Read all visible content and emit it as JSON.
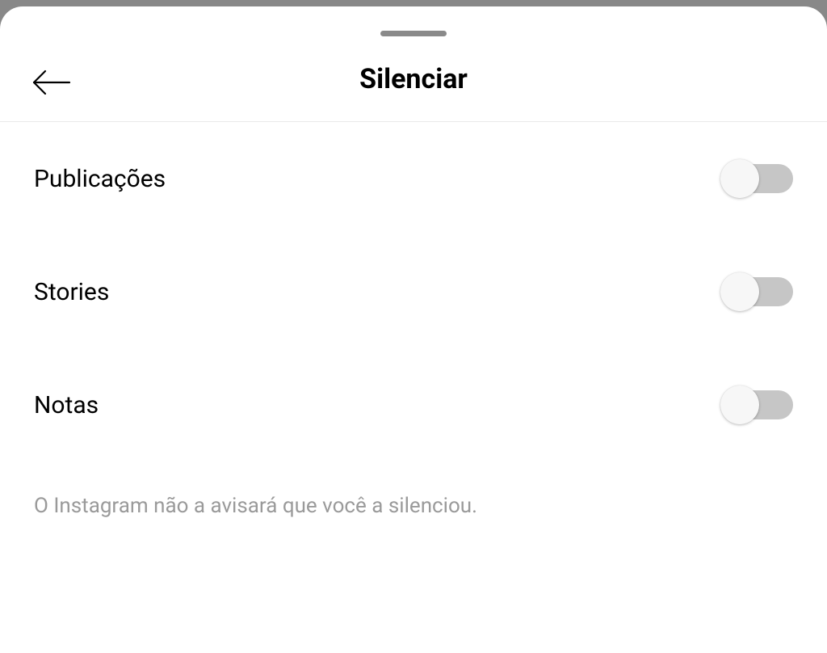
{
  "header": {
    "title": "Silenciar"
  },
  "options": [
    {
      "label": "Publicações",
      "on": false
    },
    {
      "label": "Stories",
      "on": false
    },
    {
      "label": "Notas",
      "on": false
    }
  ],
  "footer": {
    "note": "O Instagram não a avisará que você a silenciou."
  }
}
